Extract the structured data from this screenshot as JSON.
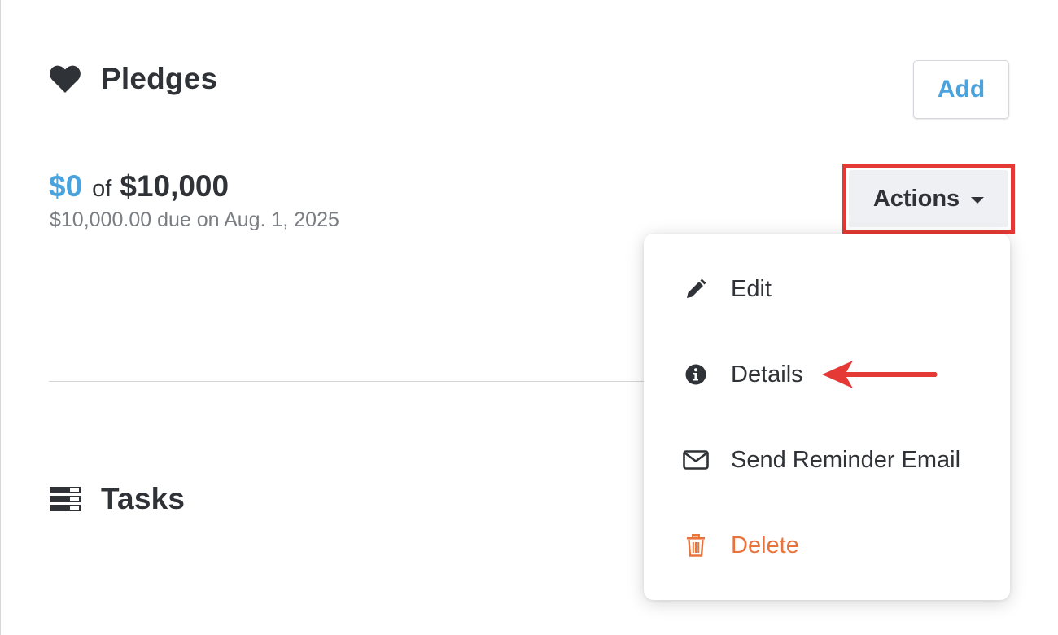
{
  "pledges": {
    "title": "Pledges",
    "icon": "heart-icon",
    "add_label": "Add",
    "amount_paid": "$0",
    "amount_of": "of",
    "amount_total": "$10,000",
    "due_text": "$10,000.00 due on Aug. 1, 2025",
    "actions_label": "Actions"
  },
  "actions_menu": {
    "items": [
      {
        "label": "Edit",
        "icon": "pencil-icon"
      },
      {
        "label": "Details",
        "icon": "info-circle-icon"
      },
      {
        "label": "Send Reminder Email",
        "icon": "envelope-icon"
      },
      {
        "label": "Delete",
        "icon": "trash-icon",
        "color": "#e8733d"
      }
    ]
  },
  "tasks": {
    "title": "Tasks",
    "icon": "tasks-list-icon"
  },
  "colors": {
    "accent": "#4aa3dd",
    "text": "#2f3237",
    "muted": "#7a7d82",
    "danger": "#e8733d",
    "highlight": "#e53935"
  }
}
